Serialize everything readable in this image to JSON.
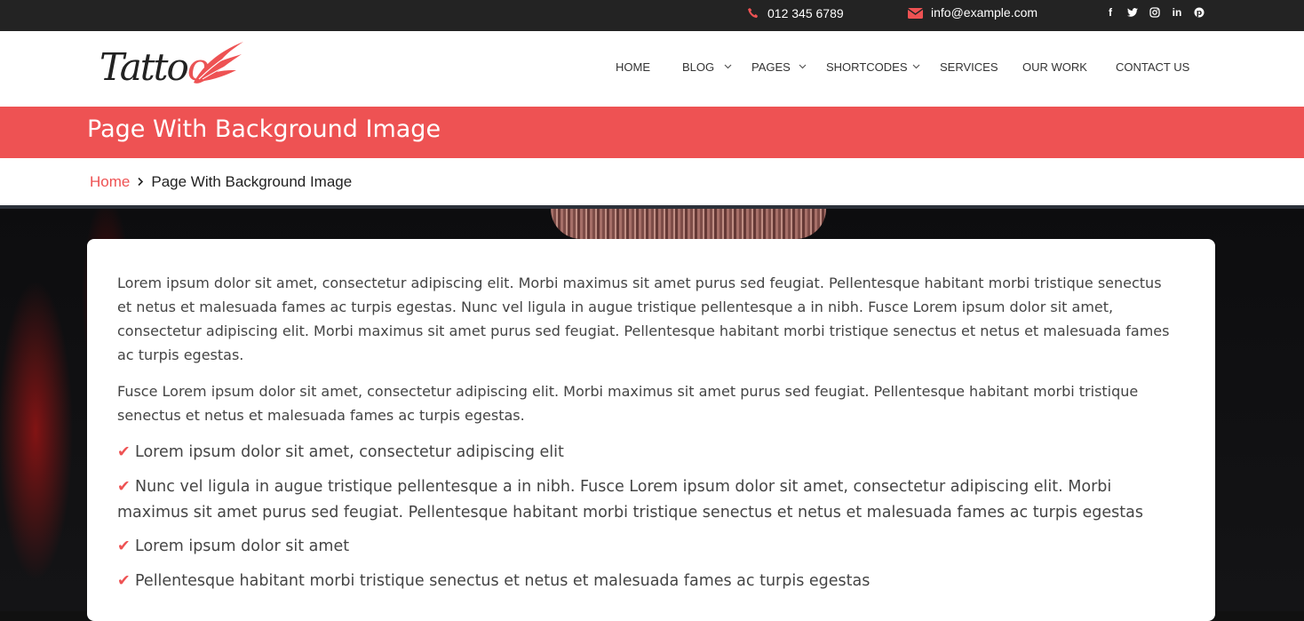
{
  "topbar": {
    "phone": "012 345 6789",
    "email": "info@example.com",
    "social": [
      "facebook-icon",
      "twitter-icon",
      "instagram-icon",
      "linkedin-icon",
      "pinterest-icon"
    ]
  },
  "logo": {
    "text_main": "Tatto",
    "text_accent": "o"
  },
  "nav": {
    "home": "HOME",
    "blog": "BLOG",
    "pages": "PAGES",
    "shortcodes": "SHORTCODES",
    "services": "SERVICES",
    "our_work": "OUR WORK",
    "contact": "CONTACT US"
  },
  "page": {
    "title": "Page With Background Image"
  },
  "breadcrumb": {
    "home": "Home",
    "current": "Page With Background Image"
  },
  "content": {
    "paragraph1": "Lorem ipsum dolor sit amet, consectetur adipiscing elit. Morbi maximus sit amet purus sed feugiat. Pellentesque habitant morbi tristique senectus et netus et malesuada fames ac turpis egestas. Nunc vel ligula in augue tristique pellentesque a in nibh. Fusce Lorem ipsum dolor sit amet, consectetur adipiscing elit. Morbi maximus sit amet purus sed feugiat. Pellentesque habitant morbi tristique senectus et netus et malesuada fames ac turpis egestas.",
    "paragraph2": "Fusce Lorem ipsum dolor sit amet, consectetur adipiscing elit. Morbi maximus sit amet purus sed feugiat. Pellentesque habitant morbi tristique senectus et netus et malesuada fames ac turpis egestas.",
    "list": [
      "Lorem ipsum dolor sit amet, consectetur adipiscing elit",
      "Nunc vel ligula in augue tristique pellentesque a in nibh. Fusce Lorem ipsum dolor sit amet, consectetur adipiscing elit. Morbi maximus sit amet purus sed feugiat. Pellentesque habitant morbi tristique senectus et netus et malesuada fames ac turpis egestas",
      "Lorem ipsum dolor sit amet",
      "Pellentesque habitant morbi tristique senectus et netus et malesuada fames ac turpis egestas"
    ]
  },
  "colors": {
    "accent": "#ee5253",
    "topbar": "#232323",
    "text": "#444444"
  }
}
